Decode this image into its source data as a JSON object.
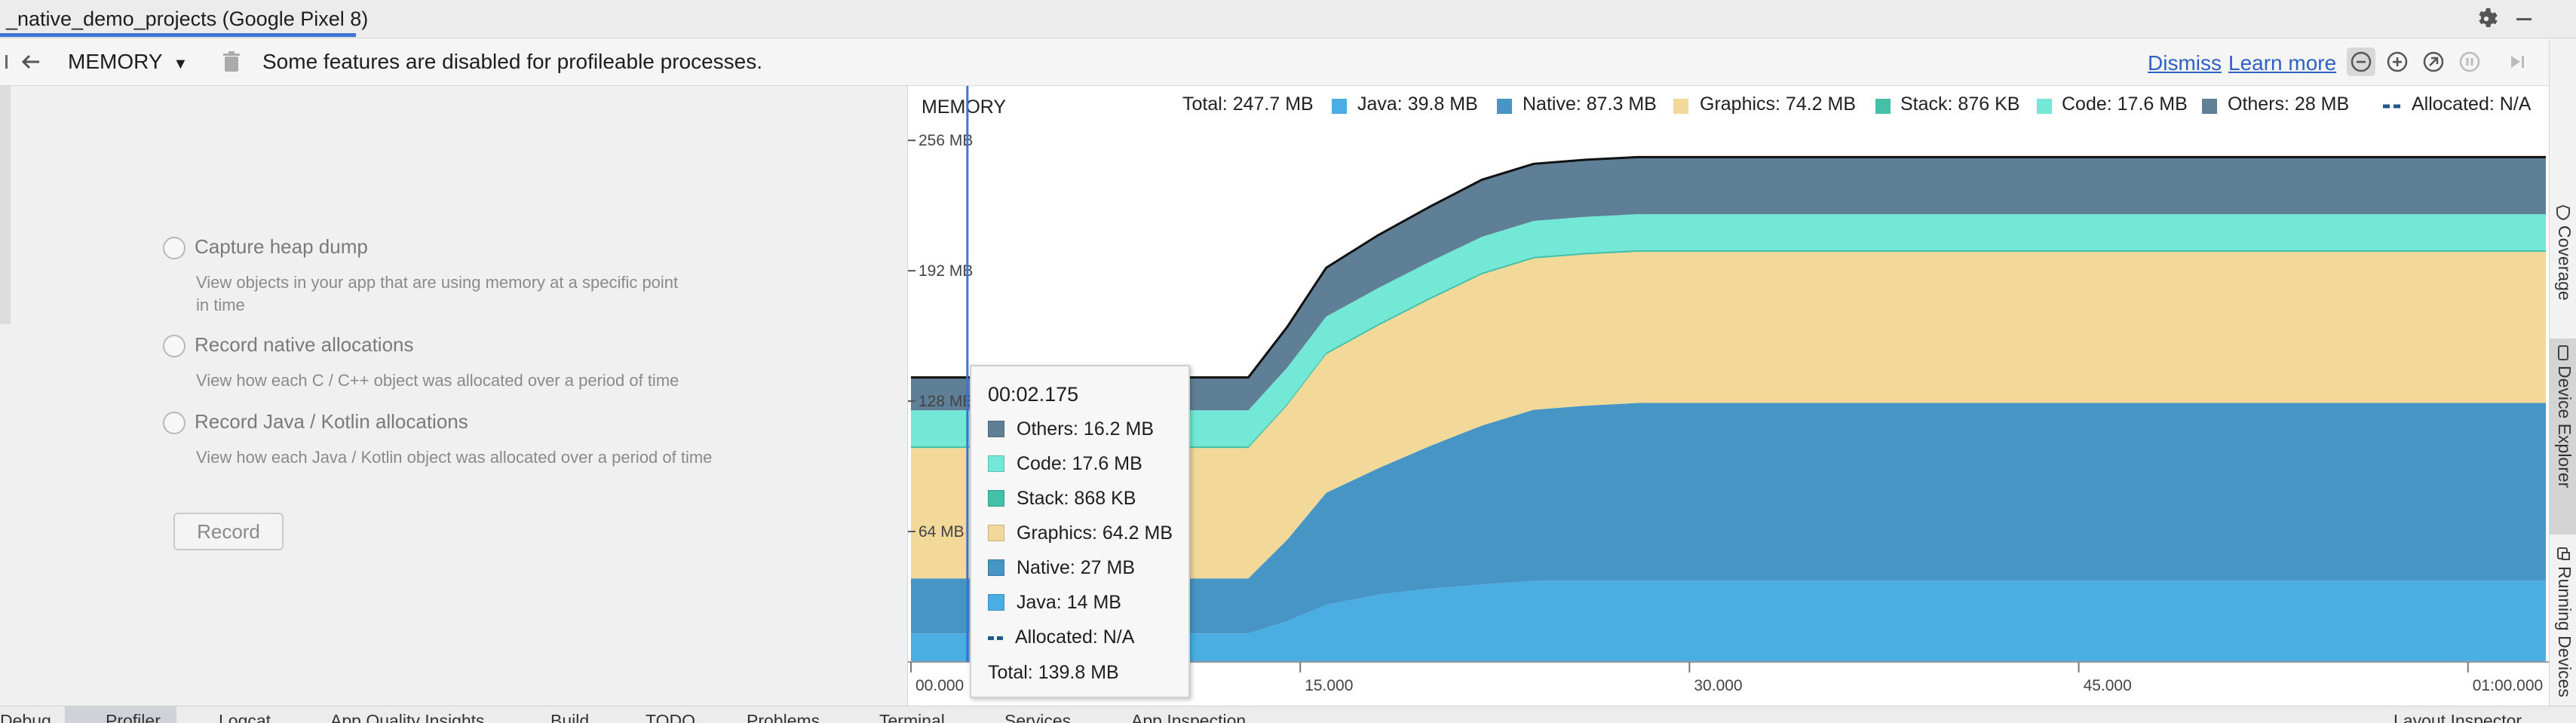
{
  "window": {
    "title": "_native_demo_projects (Google Pixel 8)"
  },
  "toolbar": {
    "profiler_selector": "MEMORY",
    "notice": "Some features are disabled for profileable processes.",
    "dismiss_link": "Dismiss",
    "learn_more_link": "Learn more"
  },
  "options": [
    {
      "label": "Capture heap dump",
      "description_line1": "View objects in your app that are using memory at a specific point",
      "description_line2": "in time"
    },
    {
      "label": "Record native allocations",
      "description_line1": "View how each C / C++ object was allocated over a period of time"
    },
    {
      "label": "Record Java / Kotlin allocations",
      "description_line1": "View how each Java / Kotlin object was allocated over a period of time"
    }
  ],
  "record_button": "Record",
  "legend": {
    "title": "MEMORY",
    "total": "Total: 247.7 MB",
    "java": "Java: 39.8 MB",
    "native": "Native: 87.3 MB",
    "graphics": "Graphics: 74.2 MB",
    "stack": "Stack: 876 KB",
    "code": "Code: 17.6 MB",
    "others": "Others: 28 MB",
    "allocated": "Allocated: N/A"
  },
  "colors": {
    "java": "#4aaee3",
    "native": "#4795c4",
    "graphics": "#f2d899",
    "stack": "#44c0a8",
    "code": "#74e8d6",
    "others": "#5f7f97",
    "selection_line": "#3d74d6"
  },
  "tooltip": {
    "time": "00:02.175",
    "others": "Others: 16.2 MB",
    "code": "Code: 17.6 MB",
    "stack": "Stack: 868 KB",
    "graphics": "Graphics: 64.2 MB",
    "native": "Native: 27 MB",
    "java": "Java: 14 MB",
    "allocated": "Allocated: N/A",
    "total": "Total: 139.8 MB"
  },
  "chart_data": {
    "type": "area",
    "title": "MEMORY",
    "y_unit": "MB",
    "y_ticks": [
      "256 MB",
      "192 MB",
      "128 MB",
      "64 MB"
    ],
    "x_ticks": [
      "00.000",
      "15.000",
      "30.000",
      "45.000",
      "01:00.000"
    ],
    "xlim_seconds": [
      0,
      63
    ],
    "ylim_mb": [
      0,
      262
    ],
    "stacked": true,
    "x": [
      0,
      1.5,
      2.175,
      3,
      6,
      10,
      13,
      14.5,
      16,
      18,
      20,
      22,
      24,
      26,
      28,
      30,
      40,
      63
    ],
    "series": [
      {
        "name": "Java",
        "values": [
          14,
          14,
          14,
          14,
          14,
          14,
          14,
          20,
          28,
          33,
          36,
          38,
          39.8,
          39.8,
          39.8,
          39.8,
          39.8,
          39.8
        ]
      },
      {
        "name": "Native",
        "values": [
          27,
          27,
          27,
          27,
          27,
          27,
          27,
          40,
          55,
          62,
          70,
          78,
          84,
          86,
          87.3,
          87.3,
          87.3,
          87.3
        ]
      },
      {
        "name": "Graphics",
        "values": [
          64,
          64,
          64,
          64,
          64,
          64,
          64,
          66,
          68,
          70,
          72,
          74.2,
          74.2,
          74.2,
          74.2,
          74.2,
          74.2,
          74.2
        ]
      },
      {
        "name": "Stack",
        "values": [
          0.87,
          0.87,
          0.87,
          0.87,
          0.87,
          0.87,
          0.87,
          0.87,
          0.87,
          0.87,
          0.87,
          0.88,
          0.88,
          0.88,
          0.88,
          0.88,
          0.88,
          0.88
        ]
      },
      {
        "name": "Code",
        "values": [
          17.6,
          17.6,
          17.6,
          17.6,
          17.6,
          17.6,
          17.6,
          17.6,
          17.6,
          17.6,
          17.6,
          17.6,
          17.6,
          17.6,
          17.6,
          17.6,
          17.6,
          17.6
        ]
      },
      {
        "name": "Others",
        "values": [
          16.2,
          16.2,
          16.2,
          16.2,
          16.2,
          16.2,
          16.2,
          20,
          24,
          26,
          27,
          28,
          28,
          28,
          28,
          28,
          28,
          28
        ]
      }
    ],
    "selection_time_seconds": 2.175
  },
  "right_tabs": [
    "Coverage",
    "Device Explorer",
    "Running Devices"
  ],
  "bottom_tabs": [
    "Debug",
    "Profiler",
    "Logcat",
    "App Quality Insights",
    "Build",
    "TODO",
    "Problems",
    "Terminal",
    "Services",
    "App Inspection",
    "Layout Inspector"
  ]
}
